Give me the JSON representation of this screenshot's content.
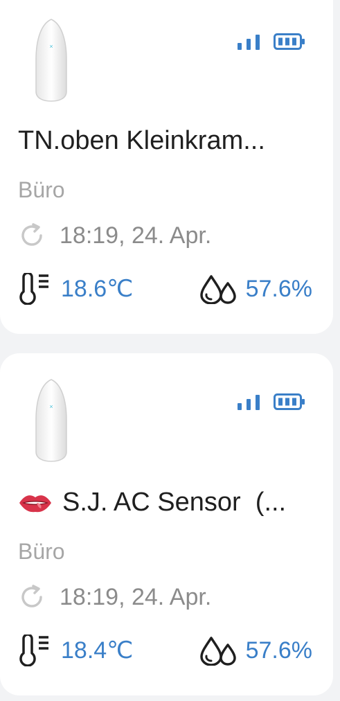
{
  "devices": [
    {
      "name": "TN.oben Kleinkram...",
      "emoji": "",
      "room": "Büro",
      "updated": "18:19, 24. Apr.",
      "temperature": "18.6℃",
      "humidity": "57.6%",
      "signal_icon": "signal-strength-icon",
      "battery_icon": "battery-full-icon"
    },
    {
      "name": "S.J. AC Sensor  (...",
      "emoji": "lips-emoji",
      "room": "Büro",
      "updated": "18:19, 24. Apr.",
      "temperature": "18.4℃",
      "humidity": "57.6%",
      "signal_icon": "signal-strength-icon",
      "battery_icon": "battery-full-icon"
    }
  ],
  "colors": {
    "accent": "#3a7fc8",
    "name_text": "#1f1f1f",
    "room_text": "#a6a6a6",
    "time_text": "#8b8b8b",
    "card_bg": "#ffffff",
    "page_bg": "#f2f3f5"
  }
}
